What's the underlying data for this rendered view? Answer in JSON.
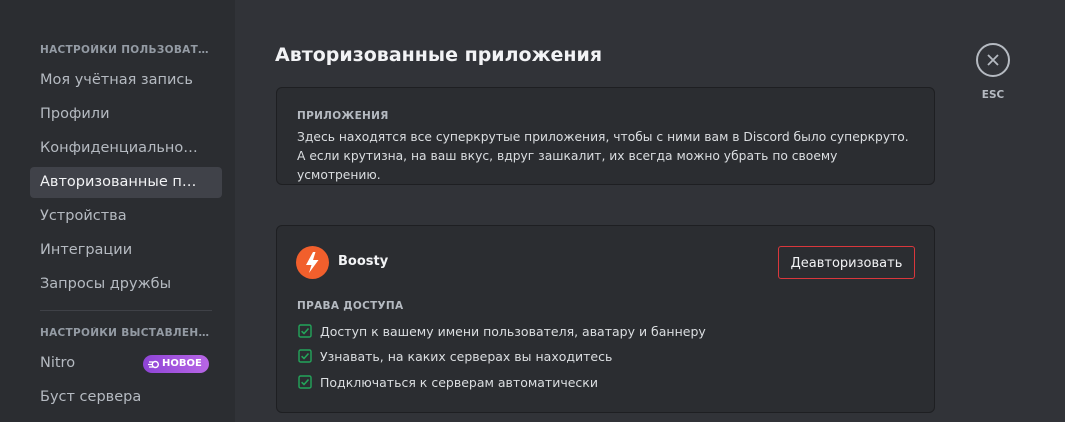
{
  "sidebar": {
    "user_settings_header": "НАСТРОЙКИ ПОЛЬЗОВАТЕЛЯ",
    "items": [
      {
        "label": "Моя учётная запись"
      },
      {
        "label": "Профили"
      },
      {
        "label": "Конфиденциальность"
      },
      {
        "label": "Авторизованные приложения"
      },
      {
        "label": "Устройства"
      },
      {
        "label": "Интеграции"
      },
      {
        "label": "Запросы дружбы"
      }
    ],
    "billing_header": "НАСТРОЙКИ ВЫСТАВЛЕНИЯ СЧЕТОВ",
    "billing_items": [
      {
        "label": "Nitro",
        "badge": "НОВОЕ"
      },
      {
        "label": "Буст сервера"
      }
    ],
    "selected_index": 3
  },
  "main": {
    "title": "Авторизованные приложения",
    "info_box": {
      "label": "ПРИЛОЖЕНИЯ",
      "text": "Здесь находятся все суперкрутые приложения, чтобы с ними вам в Discord было суперкруто. А если крутизна, на ваш вкус, вдруг зашкалит, их всегда можно убрать по своему усмотрению."
    },
    "app": {
      "name": "Boosty",
      "icon": "boosty-logo",
      "deauthorize_label": "Деавторизовать",
      "permissions_label": "ПРАВА ДОСТУПА",
      "permissions": [
        "Доступ к вашему имени пользователя, аватару и баннеру",
        "Узнавать, на каких серверах вы находитесь",
        "Подключаться к серверам автоматически"
      ]
    }
  },
  "close": {
    "icon": "close-icon",
    "label": "ESC"
  },
  "colors": {
    "accent_danger": "#da373c",
    "check_green": "#23a55a",
    "badge_purple": "#9b59d6",
    "boosty_orange": "#f15f2c"
  }
}
